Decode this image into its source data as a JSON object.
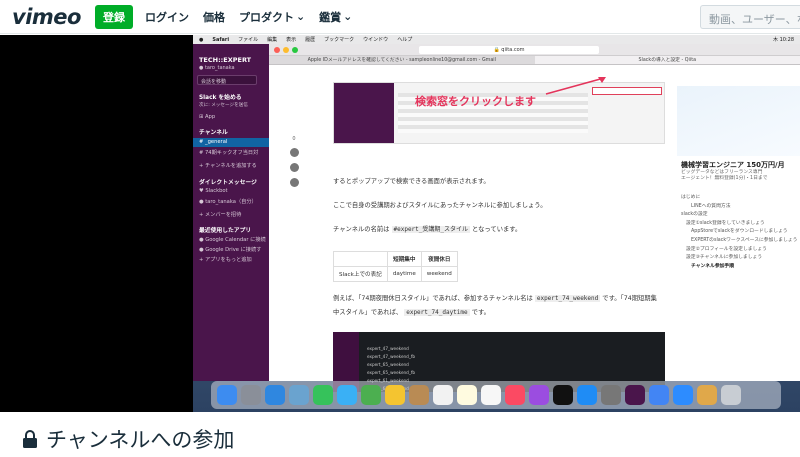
{
  "vimeo": {
    "logo": "vimeo",
    "join_label": "登録",
    "nav": [
      "ログイン",
      "価格",
      "プロダクト",
      "鑑賞"
    ],
    "search_placeholder": "動画、ユーザー、なと"
  },
  "mac": {
    "menubar": [
      "Safari",
      "ファイル",
      "編集",
      "表示",
      "履歴",
      "ブックマーク",
      "ウインドウ",
      "ヘルプ"
    ],
    "clock": "木 10:28"
  },
  "slack": {
    "workspace": "TECH::EXPERT",
    "user": "taro_tanaka",
    "move_button": "会話を移動",
    "start_header": "Slack を始める",
    "start_sub": "次に: メッセージを送信",
    "app": "App",
    "channels_header": "チャンネル",
    "channels": [
      "_general",
      "74期キックオフ当日対"
    ],
    "add_channel": "+ チャンネルを追加する",
    "dm_header": "ダイレクトメッセージ",
    "dms": [
      "Slackbot",
      "taro_tanaka（自分）"
    ],
    "invite": "+ メンバーを招待",
    "recent_header": "最近使用したアプリ",
    "recent": [
      "Google Calendar に接続",
      "Google Drive に接続す",
      "+ アプリをもっと追加"
    ]
  },
  "safari": {
    "url": "qiita.com",
    "tabs": [
      "Apple IDメールアドレスを確認してください - sampleonline10@gmail.com - Gmail",
      "Slackの導入と設定 - Qiita"
    ],
    "active_tab": 1
  },
  "article": {
    "share_count": "0",
    "callout": "検索窓をクリックします",
    "p1": "するとポップアップで検索できる画面が表示されます。",
    "p2": "ここで自身の受講期およびスタイルにあったチャンネルに参加しましょう。",
    "p3_before": "チャンネルの名前は",
    "p3_code": "#expert_受講期_スタイル",
    "p3_after": "となっています。",
    "table": {
      "headers": [
        "",
        "短期集中",
        "夜間休日"
      ],
      "row": [
        "Slack上での表記",
        "daytime",
        "weekend"
      ]
    },
    "p4_a": "例えば、「74期夜間休日スタイル」であれば、参加するチャンネル名は",
    "p4_code1": "expert_74_weekend",
    "p4_b": "です。「74期短期集",
    "p4_c": "中スタイル」であれば、",
    "p4_code2": "expert_74_daytime",
    "p4_d": "です。",
    "shot2_lines": [
      "expert_47_weekend",
      "expert_47_weekend_fb",
      "expert_65_weekend",
      "expert_65_weekend_fb",
      "expert_61_weekend",
      "expert_62_weekend"
    ]
  },
  "sidebar": {
    "ad_title": "機械学習エンジニア 150万円/月",
    "ad_sub": [
      "ビッグデータなどはフリーランス専門",
      "エージェント！無料登録(1分)・1日まで"
    ],
    "toc": [
      "はじめに",
      "LINEへの質問方法",
      "slackの設定",
      "設定①slack登録をしていきましょう",
      "AppStoreでslackをダウンロードしましょう",
      "EXPERTのslackワークスペースに参加しましょう",
      "設定②プロフィールを設定しましょう",
      "設定③チャンネルに参加しましょう",
      "チャンネル参加手順"
    ]
  },
  "caption": {
    "title": "チャンネルへの参加"
  },
  "colors": {
    "vimeo_green": "#00ad28",
    "slack_purple": "#4a154b",
    "slack_active": "#1164a3",
    "callout_red": "#e4345b"
  }
}
